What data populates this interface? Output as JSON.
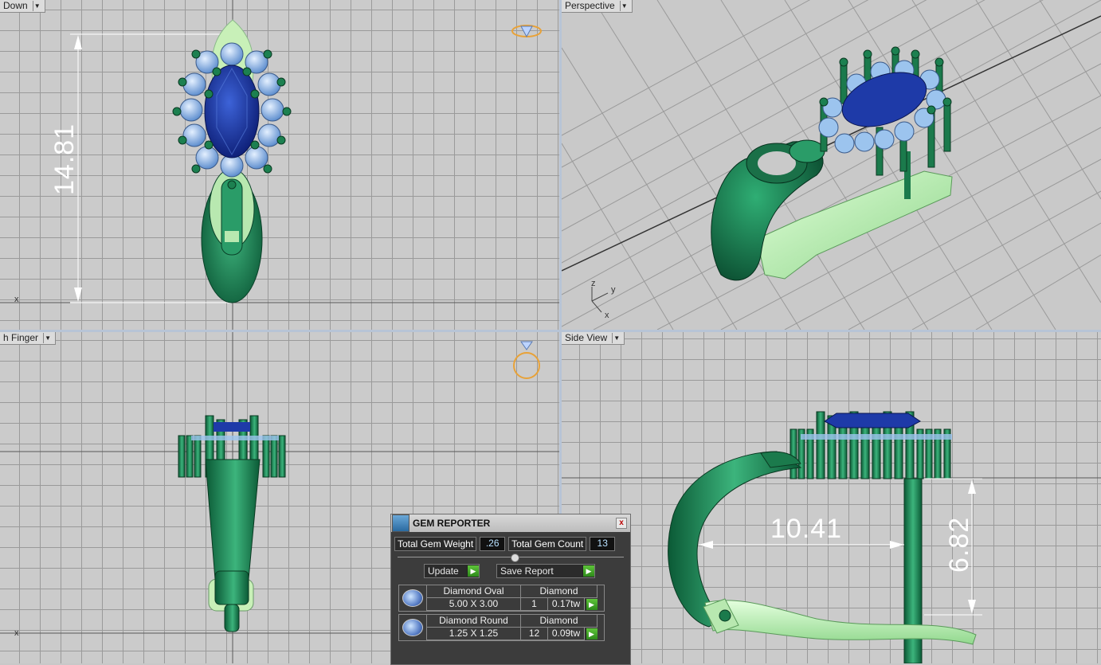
{
  "viewports": {
    "top_left": {
      "label": "Down"
    },
    "top_right": {
      "label": "Perspective",
      "axes": {
        "z": "z",
        "y": "y",
        "x": "x"
      }
    },
    "bottom_left": {
      "label": "h Finger",
      "axis_x": "x"
    },
    "bottom_right": {
      "label": "Side View"
    }
  },
  "top_left_axis": "x",
  "dimensions": {
    "height": "14.81",
    "width": "10.41",
    "depth": "6.82"
  },
  "gem_reporter": {
    "title": "GEM REPORTER",
    "close": "x",
    "total_weight_label": "Total Gem Weight",
    "total_weight_value": ".26",
    "total_count_label": "Total Gem Count",
    "total_count_value": "13",
    "update_label": "Update",
    "save_label": "Save Report",
    "gems": [
      {
        "name": "Diamond Oval",
        "type": "Diamond",
        "size": "5.00 X 3.00",
        "qty": "1",
        "weight": "0.17tw"
      },
      {
        "name": "Diamond Round",
        "type": "Diamond",
        "size": "1.25 X 1.25",
        "qty": "12",
        "weight": "0.09tw"
      }
    ]
  },
  "colors": {
    "metal_green": "#1f8a5a",
    "light_green": "#c8f0c0",
    "sapphire": "#1e3aa8",
    "diamond": "#9cc4ee"
  }
}
